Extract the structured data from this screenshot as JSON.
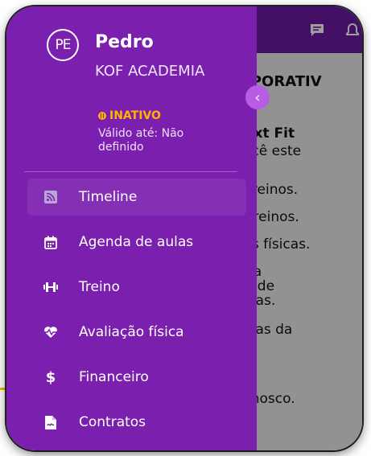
{
  "background": {
    "heading": "RPORATIV",
    "lines": [
      "ext Fit",
      "você este",
      "s treinos.",
      "e treinos.",
      "ões físicas.",
      "da",
      "o de",
      "tras.",
      "tícias da",
      "conosco."
    ]
  },
  "drawer": {
    "avatar_initials": "PE",
    "user_name": "Pedro",
    "company": "KOF ACADEMIA",
    "status": "INATIVO",
    "validity": "Válido até: Não definido",
    "menu": [
      {
        "label": "Timeline",
        "icon": "rss-icon"
      },
      {
        "label": "Agenda de aulas",
        "icon": "calendar-icon"
      },
      {
        "label": "Treino",
        "icon": "dumbbell-icon"
      },
      {
        "label": "Avaliação física",
        "icon": "heart-pulse-icon"
      },
      {
        "label": "Financeiro",
        "icon": "dollar-icon"
      },
      {
        "label": "Contratos",
        "icon": "document-icon"
      }
    ]
  },
  "colors": {
    "drawer_bg": "#7b1fae",
    "header_bg": "#6d1aa3",
    "status": "#ffb300",
    "accent_button": "#b85ce6"
  }
}
